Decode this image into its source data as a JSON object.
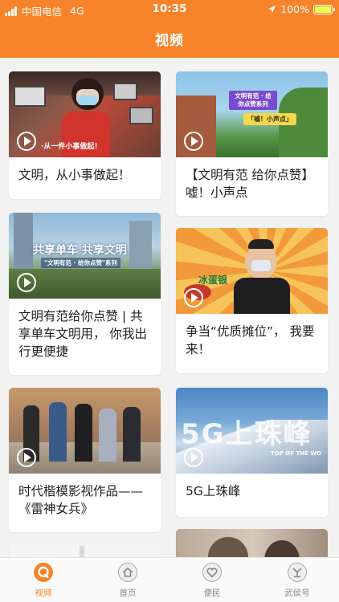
{
  "status": {
    "carrier": "中国电信",
    "network": "4G",
    "time": "10:35",
    "battery": "100%"
  },
  "nav": {
    "title": "视频"
  },
  "cards": [
    {
      "title": "文明，从小事做起！",
      "overlay": "·从一件小事做起！"
    },
    {
      "title": "【文明有范 给你点赞】嘘！小声点",
      "overlay": "文明有范 · 给你点赞系列",
      "overlay2": "「嘘！小声点」"
    },
    {
      "title": "文明有范给你点赞 | 共享单车文明用， 你我出行更便捷",
      "overlay": "共享单车  共享文明",
      "overlay2": "\"文明有范 · 给你点赞\"系列"
    },
    {
      "title": "争当“优质摊位”， 我要来！",
      "overlay": "冰蛋银"
    },
    {
      "title": "时代楷模影视作品——《雷神女兵》"
    },
    {
      "title": "5G上珠峰",
      "overlay": "5G上珠峰",
      "overlay2": "TOP OF THE WO"
    }
  ],
  "tabs": [
    {
      "label": "视频",
      "icon": "video-icon",
      "active": true
    },
    {
      "label": "首页",
      "icon": "home-icon"
    },
    {
      "label": "便民",
      "icon": "heart-service-icon"
    },
    {
      "label": "武侯号",
      "icon": "wuhou-icon"
    }
  ],
  "colors": {
    "accent": "#f7842a"
  }
}
